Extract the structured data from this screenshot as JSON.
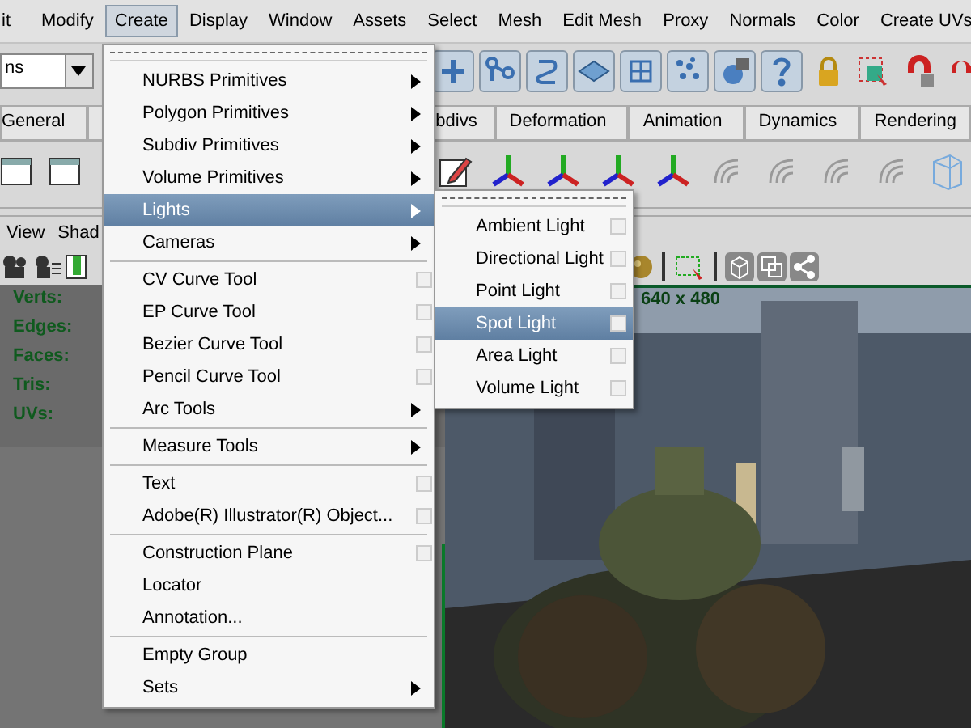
{
  "menubar": [
    {
      "label": "it",
      "selected": false
    },
    {
      "label": "Modify",
      "selected": false
    },
    {
      "label": "Create",
      "selected": true
    },
    {
      "label": "Display",
      "selected": false
    },
    {
      "label": "Window",
      "selected": false
    },
    {
      "label": "Assets",
      "selected": false
    },
    {
      "label": "Select",
      "selected": false
    },
    {
      "label": "Mesh",
      "selected": false
    },
    {
      "label": "Edit Mesh",
      "selected": false
    },
    {
      "label": "Proxy",
      "selected": false
    },
    {
      "label": "Normals",
      "selected": false
    },
    {
      "label": "Color",
      "selected": false
    },
    {
      "label": "Create UVs",
      "selected": false
    }
  ],
  "toolbar": {
    "dropdown": "ns"
  },
  "shelf_tabs": [
    {
      "label": "General",
      "selected": false
    },
    {
      "label": "bdivs",
      "selected": false
    },
    {
      "label": "Deformation",
      "selected": false
    },
    {
      "label": "Animation",
      "selected": false
    },
    {
      "label": "Dynamics",
      "selected": false
    },
    {
      "label": "Rendering",
      "selected": false
    }
  ],
  "panel_menu": [
    "View",
    "Shad"
  ],
  "hud": {
    "labels": [
      "Verts:",
      "Edges:",
      "Faces:",
      "Tris:",
      "UVs:"
    ],
    "resolution": "640 x 480"
  },
  "create_menu": {
    "tearoff": true,
    "items": [
      {
        "kind": "item",
        "label": "NURBS Primitives",
        "submenu": true,
        "option_box": false,
        "selected": false
      },
      {
        "kind": "item",
        "label": "Polygon Primitives",
        "submenu": true,
        "option_box": false,
        "selected": false
      },
      {
        "kind": "item",
        "label": "Subdiv Primitives",
        "submenu": true,
        "option_box": false,
        "selected": false
      },
      {
        "kind": "item",
        "label": "Volume Primitives",
        "submenu": true,
        "option_box": false,
        "selected": false
      },
      {
        "kind": "item",
        "label": "Lights",
        "submenu": true,
        "option_box": false,
        "selected": true
      },
      {
        "kind": "item",
        "label": "Cameras",
        "submenu": true,
        "option_box": false,
        "selected": false
      },
      {
        "kind": "separator"
      },
      {
        "kind": "item",
        "label": "CV Curve Tool",
        "submenu": false,
        "option_box": true,
        "selected": false
      },
      {
        "kind": "item",
        "label": "EP Curve Tool",
        "submenu": false,
        "option_box": true,
        "selected": false
      },
      {
        "kind": "item",
        "label": "Bezier Curve Tool",
        "submenu": false,
        "option_box": true,
        "selected": false
      },
      {
        "kind": "item",
        "label": "Pencil Curve Tool",
        "submenu": false,
        "option_box": true,
        "selected": false
      },
      {
        "kind": "item",
        "label": "Arc Tools",
        "submenu": true,
        "option_box": false,
        "selected": false
      },
      {
        "kind": "separator"
      },
      {
        "kind": "item",
        "label": "Measure Tools",
        "submenu": true,
        "option_box": false,
        "selected": false
      },
      {
        "kind": "separator"
      },
      {
        "kind": "item",
        "label": "Text",
        "submenu": false,
        "option_box": true,
        "selected": false
      },
      {
        "kind": "item",
        "label": "Adobe(R) Illustrator(R) Object...",
        "submenu": false,
        "option_box": true,
        "selected": false
      },
      {
        "kind": "separator"
      },
      {
        "kind": "item",
        "label": "Construction Plane",
        "submenu": false,
        "option_box": true,
        "selected": false
      },
      {
        "kind": "item",
        "label": "Locator",
        "submenu": false,
        "option_box": false,
        "selected": false
      },
      {
        "kind": "item",
        "label": "Annotation...",
        "submenu": false,
        "option_box": false,
        "selected": false
      },
      {
        "kind": "separator"
      },
      {
        "kind": "item",
        "label": "Empty Group",
        "submenu": false,
        "option_box": false,
        "selected": false
      },
      {
        "kind": "item",
        "label": "Sets",
        "submenu": true,
        "option_box": false,
        "selected": false
      }
    ]
  },
  "lights_submenu": {
    "tearoff": true,
    "items": [
      {
        "kind": "item",
        "label": "Ambient Light",
        "submenu": false,
        "option_box": true,
        "selected": false
      },
      {
        "kind": "item",
        "label": "Directional Light",
        "submenu": false,
        "option_box": true,
        "selected": false
      },
      {
        "kind": "item",
        "label": "Point Light",
        "submenu": false,
        "option_box": true,
        "selected": false
      },
      {
        "kind": "item",
        "label": "Spot Light",
        "submenu": false,
        "option_box": true,
        "selected": true
      },
      {
        "kind": "item",
        "label": "Area Light",
        "submenu": false,
        "option_box": true,
        "selected": false
      },
      {
        "kind": "item",
        "label": "Volume Light",
        "submenu": false,
        "option_box": true,
        "selected": false
      }
    ]
  }
}
